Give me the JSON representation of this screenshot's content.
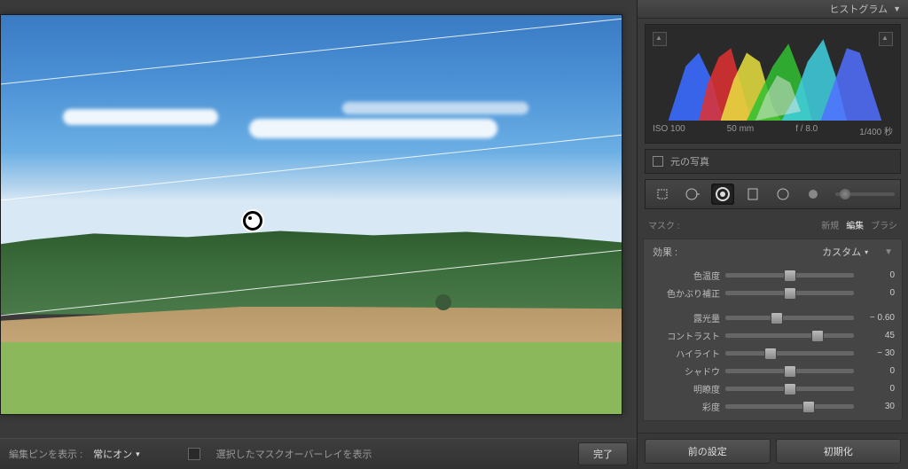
{
  "panel": {
    "histogram_title": "ヒストグラム"
  },
  "histogram_meta": {
    "iso": "ISO 100",
    "focal": "50 mm",
    "aperture": "f / 8.0",
    "shutter": "1/400 秒"
  },
  "original_photo_label": "元の写真",
  "tools": {
    "crop": "crop",
    "spot": "spot",
    "radial_active": "gradient-radial",
    "rect": "rect",
    "circle": "circle"
  },
  "mask": {
    "label": "マスク :",
    "mode_new": "新規",
    "mode_edit": "編集",
    "mode_brush": "ブラシ"
  },
  "effect": {
    "label": "効果 :",
    "preset": "カスタム",
    "disclosure": "▼"
  },
  "sliders": {
    "temp": {
      "label": "色温度",
      "value": "0",
      "pos": 50
    },
    "tint": {
      "label": "色かぶり補正",
      "value": "0",
      "pos": 50
    },
    "exposure": {
      "label": "露光量",
      "value": "− 0.60",
      "pos": 40
    },
    "contrast": {
      "label": "コントラスト",
      "value": "45",
      "pos": 72
    },
    "highlight": {
      "label": "ハイライト",
      "value": "− 30",
      "pos": 35
    },
    "shadow": {
      "label": "シャドウ",
      "value": "0",
      "pos": 50
    },
    "clarity": {
      "label": "明瞭度",
      "value": "0",
      "pos": 50
    },
    "sat": {
      "label": "彩度",
      "value": "30",
      "pos": 65
    }
  },
  "bottom_buttons": {
    "prev": "前の設定",
    "reset": "初期化"
  },
  "bottom_bar": {
    "pins_label": "編集ピンを表示 :",
    "pins_mode": "常にオン",
    "overlay_label": "選択したマスクオーバーレイを表示",
    "done": "完了"
  }
}
